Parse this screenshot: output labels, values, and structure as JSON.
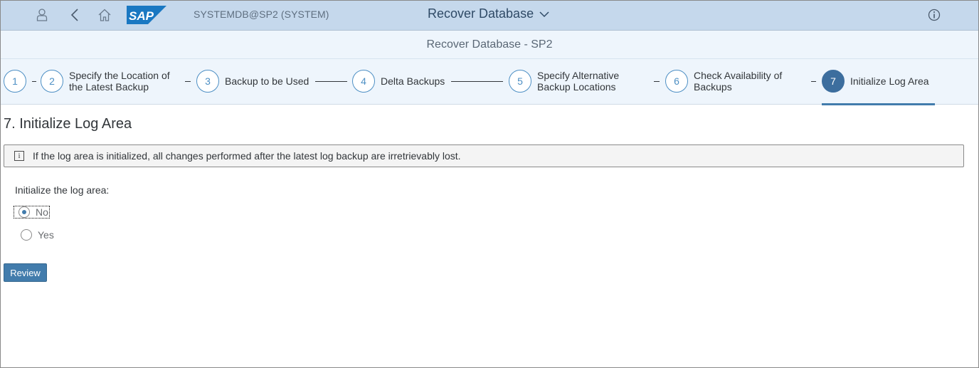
{
  "shell": {
    "system": "SYSTEMDB@SP2 (SYSTEM)",
    "app_title": "Recover Database",
    "icons": [
      "user-icon",
      "back-icon",
      "home-icon",
      "sap-logo",
      "chevron-down-icon",
      "help-icon"
    ],
    "logo_text": "SAP",
    "colors": {
      "bar": "#c5d8ec",
      "logo": "#1a78c2"
    }
  },
  "page": {
    "title": "Recover Database - SP2"
  },
  "wizard": {
    "steps": [
      {
        "num": "1",
        "label": ""
      },
      {
        "num": "2",
        "label": "Specify the Location of\nthe Latest Backup"
      },
      {
        "num": "3",
        "label": "Backup to be Used"
      },
      {
        "num": "4",
        "label": "Delta Backups"
      },
      {
        "num": "5",
        "label": "Specify Alternative\nBackup Locations"
      },
      {
        "num": "6",
        "label": "Check Availability of\nBackups"
      },
      {
        "num": "7",
        "label": "Initialize Log Area"
      }
    ],
    "active_step": 7
  },
  "content": {
    "heading": "7. Initialize Log Area",
    "message": "If the log area is initialized, all changes performed after the latest log backup are irretrievably lost.",
    "field_label": "Initialize the log area:",
    "options": [
      {
        "label": "No",
        "selected": true
      },
      {
        "label": "Yes",
        "selected": false
      }
    ],
    "review_button": "Review"
  }
}
